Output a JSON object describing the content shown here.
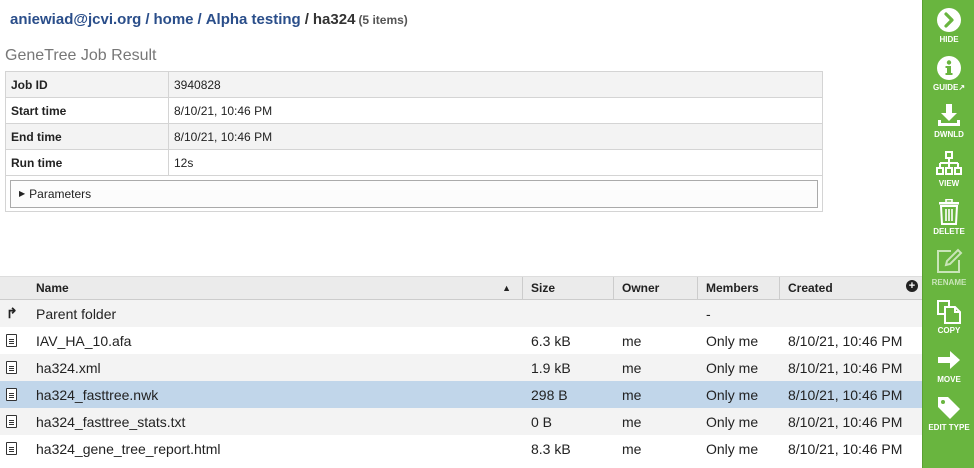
{
  "breadcrumb": {
    "user": "aniewiad@jcvi.org",
    "sep": "/",
    "home": "home",
    "folder": "Alpha testing",
    "current": "ha324",
    "count": "(5 items)"
  },
  "job_title": "GeneTree Job Result",
  "job": [
    {
      "key": "Job ID",
      "value": "3940828"
    },
    {
      "key": "Start time",
      "value": "8/10/21, 10:46 PM"
    },
    {
      "key": "End time",
      "value": "8/10/21, 10:46 PM"
    },
    {
      "key": "Run time",
      "value": "12s"
    }
  ],
  "parameters_label": "Parameters",
  "files": {
    "headers": {
      "name": "Name",
      "size": "Size",
      "owner": "Owner",
      "members": "Members",
      "created": "Created"
    },
    "parent": {
      "name": "Parent folder",
      "members": "-"
    },
    "rows": [
      {
        "name": "IAV_HA_10.afa",
        "size": "6.3 kB",
        "owner": "me",
        "members": "Only me",
        "created": "8/10/21, 10:46 PM"
      },
      {
        "name": "ha324.xml",
        "size": "1.9 kB",
        "owner": "me",
        "members": "Only me",
        "created": "8/10/21, 10:46 PM"
      },
      {
        "name": "ha324_fasttree.nwk",
        "size": "298 B",
        "owner": "me",
        "members": "Only me",
        "created": "8/10/21, 10:46 PM"
      },
      {
        "name": "ha324_fasttree_stats.txt",
        "size": "0 B",
        "owner": "me",
        "members": "Only me",
        "created": "8/10/21, 10:46 PM"
      },
      {
        "name": "ha324_gene_tree_report.html",
        "size": "8.3 kB",
        "owner": "me",
        "members": "Only me",
        "created": "8/10/21, 10:46 PM"
      }
    ]
  },
  "toolbar": {
    "hide": "HIDE",
    "guide": "GUIDE",
    "dwnld": "DWNLD",
    "view": "VIEW",
    "delete": "DELETE",
    "rename": "RENAME",
    "copy": "COPY",
    "move": "MOVE",
    "edit_type": "EDIT TYPE"
  },
  "colors": {
    "toolbar_bg": "#69b53f",
    "selected_row": "#c1d6ea",
    "link": "#2a4e8a"
  }
}
